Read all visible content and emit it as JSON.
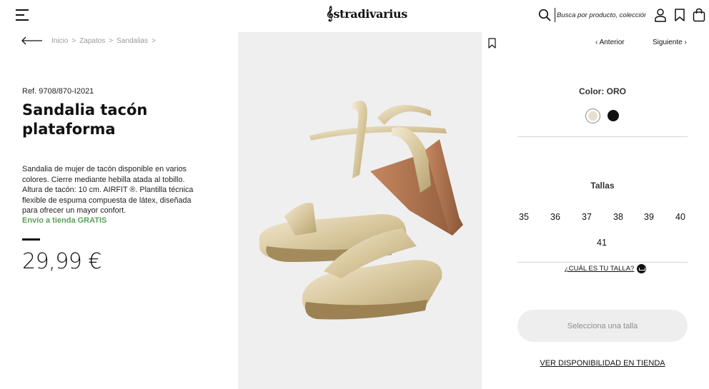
{
  "header": {
    "menu_icon": "hamburger-menu-icon",
    "logo_text": "stradivarius",
    "search": {
      "placeholder": "Busca por producto, colección…",
      "icon": "search-icon"
    },
    "icons": [
      "user-icon",
      "bookmark-icon",
      "shopping-bag-icon"
    ]
  },
  "breadcrumb": {
    "back_icon": "arrow-left-icon",
    "items": [
      "Inicio",
      "Zapatos",
      "Sandalias"
    ],
    "separator": ">"
  },
  "product": {
    "ref": "Ref. 9708/870-I2021",
    "title": "Sandalia tacón plataforma",
    "description": "Sandalia de mujer de tacón disponible en varios colores. Cierre mediante hebilla atada al tobillo. Altura de tacón: 10 cm. AIRFIT ®. Plantilla técnica flexible de espuma compuesta de látex, diseñada para ofrecer un mayor confort.",
    "shipping": "Envío a tienda GRATIS",
    "price": "29,99 €",
    "image_alt": "gold-platform-sandals-image",
    "wishlist_icon": "bookmark-icon"
  },
  "nav": {
    "prev": "Anterior",
    "next": "Siguiente",
    "prev_arrow": "‹",
    "next_arrow": "›"
  },
  "options": {
    "color_label": "Color: ORO",
    "colors": [
      {
        "name": "ORO",
        "hex": "#e9dfcf",
        "selected": true
      },
      {
        "name": "NEGRO",
        "hex": "#111111",
        "selected": false
      }
    ],
    "sizes_label": "Tallas",
    "sizes": [
      "35",
      "36",
      "37",
      "38",
      "39",
      "40",
      "41"
    ],
    "size_guide": "¿CUÁL ES TU TALLA?",
    "select_button": "Selecciona una talla",
    "store_link": "VER DISPONIBILIDAD EN TIENDA"
  },
  "colors": {
    "accent_green": "#5aa05a",
    "button_bg": "#eeeeee",
    "button_text": "#8d8d8d",
    "image_bg": "#efeff0"
  }
}
